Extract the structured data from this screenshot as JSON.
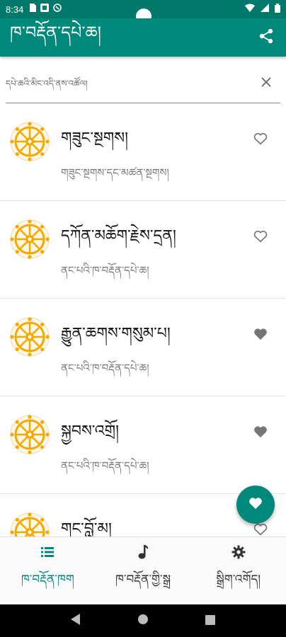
{
  "status_bar": {
    "time": "8:34"
  },
  "app_bar": {
    "title": "ཁ་བརྡོན་དཔེ་ཆ།"
  },
  "search": {
    "placeholder": "དཔེ་ཆའི་མིང་འདི་ནས་འཚོལ།"
  },
  "list": {
    "items": [
      {
        "title": "གཟུང་སྔགས།",
        "subtitle": "གཟུང་སྔགས་དང་མཚན་སྔགས།",
        "favorited": false
      },
      {
        "title": "དཀོན་མཆོག་རྗེས་དྲན།",
        "subtitle": "ནང་པའི་ཁ་བརྡོན་དཔེ་ཆ།",
        "favorited": false
      },
      {
        "title": "རྒྱུན་ཆགས་གསུམ་པ།",
        "subtitle": "ནང་པའི་ཁ་བརྡོན་དཔེ་ཆ།",
        "favorited": true
      },
      {
        "title": "སྐྱབས་འགྲོ།",
        "subtitle": "ནང་པའི་ཁ་བརྡོན་དཔེ་ཆ།",
        "favorited": true
      },
      {
        "title": "གང་བློ་མ།",
        "subtitle": "",
        "favorited": false
      }
    ]
  },
  "bottom_nav": {
    "items": [
      {
        "label": "ཁ་བརྡོན་ཁག",
        "icon": "list-icon",
        "active": true
      },
      {
        "label": "ཁ་བརྡོན་གྱི་སྒྲ",
        "icon": "music-note-icon",
        "active": false
      },
      {
        "label": "སྒྲིག་འགོད།",
        "icon": "gear-icon",
        "active": false
      }
    ]
  },
  "colors": {
    "primary": "#00897b",
    "status_bar": "#00796b",
    "wheel": "#f5a800"
  }
}
